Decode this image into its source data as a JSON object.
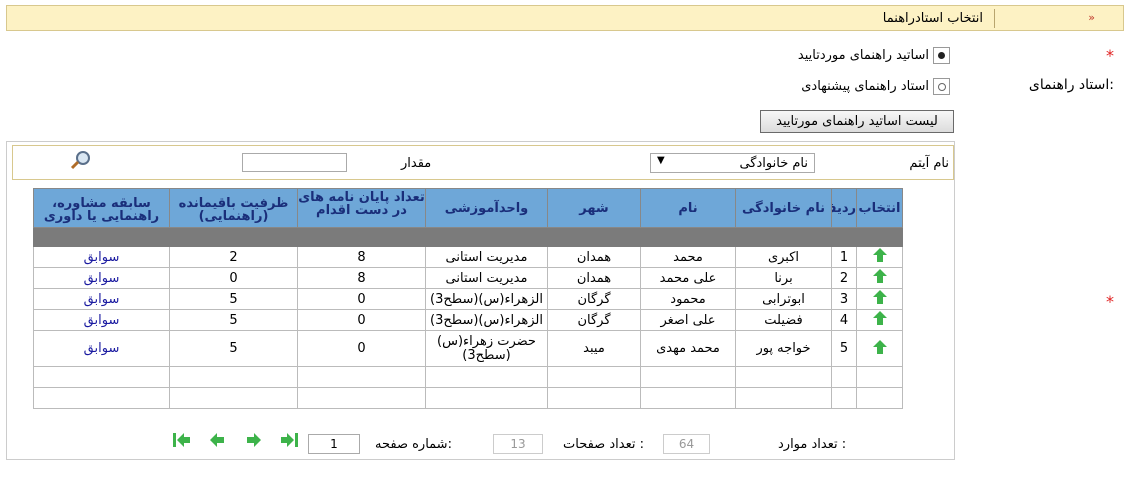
{
  "section": {
    "title": "انتخاب استادراهنما",
    "chevron": "»"
  },
  "advisor": {
    "label": "استاد راهنمای:",
    "options": [
      {
        "label": "اساتید راهنمای موردتایید",
        "selected": true
      },
      {
        "label": "استاد راهنمای پیشنهادی",
        "selected": false
      }
    ],
    "list_button": "لیست اساتید راهنمای مورتایید"
  },
  "filter": {
    "item_label": "نام آیتم",
    "item_value": "نام خانوادگی",
    "value_label": "مقدار",
    "value": ""
  },
  "table": {
    "headers": {
      "select": "انتخاب",
      "row": "ردیف",
      "last": "نام خانوادگی",
      "first": "نام",
      "city": "شهر",
      "unit": "واحدآموزشی",
      "theses": "تعداد پایان نامه های در دست اقدام",
      "capacity": "ظرفیت باقیمانده (راهنمایی)",
      "history": "سابقه مشاوره، راهنمایی یا داوری"
    },
    "rows": [
      {
        "row": "1",
        "last": "اکبری",
        "first": "محمد",
        "city": "همدان",
        "unit": "مدیریت استانی",
        "theses": "8",
        "capacity": "2",
        "history": "سوابق"
      },
      {
        "row": "2",
        "last": "برنا",
        "first": "علی محمد",
        "city": "همدان",
        "unit": "مدیریت استانی",
        "theses": "8",
        "capacity": "0",
        "history": "سوابق"
      },
      {
        "row": "3",
        "last": "ابوترابی",
        "first": "محمود",
        "city": "گرگان",
        "unit": "الزهراء(س)(سطح3)",
        "theses": "0",
        "capacity": "5",
        "history": "سوابق"
      },
      {
        "row": "4",
        "last": "فضیلت",
        "first": "علی اصغر",
        "city": "گرگان",
        "unit": "الزهراء(س)(سطح3)",
        "theses": "0",
        "capacity": "5",
        "history": "سوابق"
      },
      {
        "row": "5",
        "last": "خواجه پور",
        "first": "محمد مهدی",
        "city": "میبد",
        "unit": "حضرت زهراء(س) (سطح3)",
        "theses": "0",
        "capacity": "5",
        "history": "سوابق"
      }
    ]
  },
  "pager": {
    "records_label": "تعداد موارد :",
    "records": "64",
    "pages_label": "تعداد صفحات :",
    "pages": "13",
    "page_label": "شماره صفحه:",
    "page": "1"
  },
  "colors": {
    "header_bg": "#6ea7d8",
    "title_bg": "#fdf2c4",
    "required": "#e02020",
    "nav_green": "#3db34a"
  }
}
